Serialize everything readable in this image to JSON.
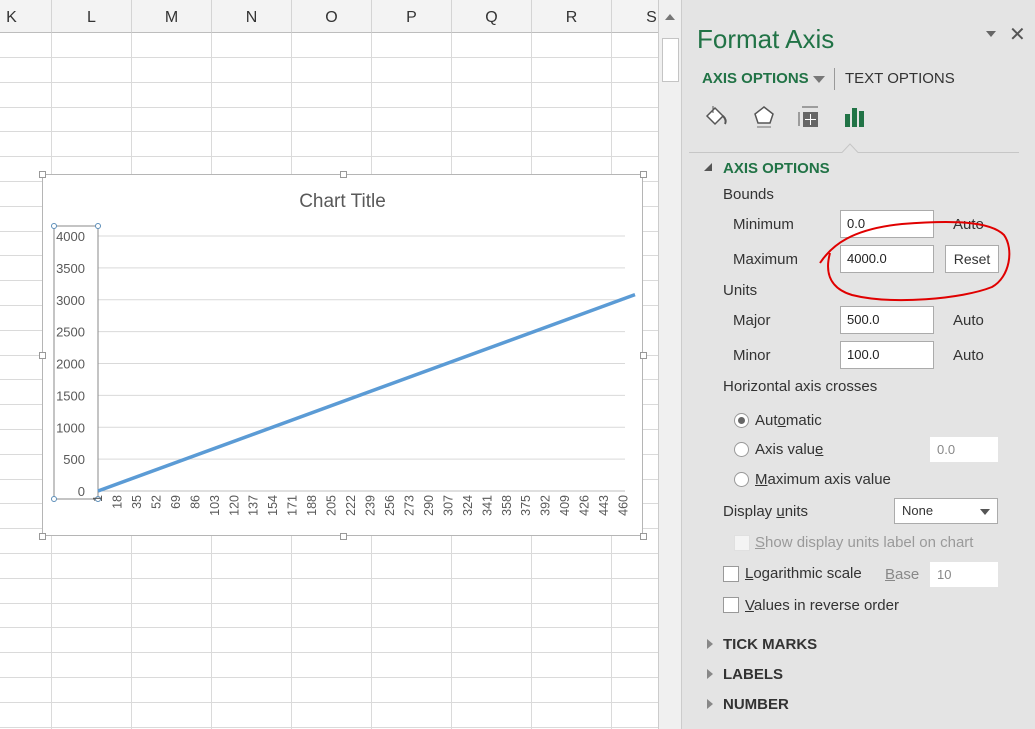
{
  "spreadsheet": {
    "columns": [
      "K",
      "L",
      "M",
      "N",
      "O",
      "P",
      "Q",
      "R",
      "S"
    ]
  },
  "chart": {
    "title": "Chart Title"
  },
  "chart_data": {
    "type": "line",
    "title": "Chart Title",
    "xlabel": "",
    "ylabel": "",
    "ylim": [
      0,
      4000
    ],
    "y_ticks": [
      "0",
      "500",
      "1000",
      "1500",
      "2000",
      "2500",
      "3000",
      "3500",
      "4000"
    ],
    "x_tick_labels": [
      "1",
      "18",
      "35",
      "52",
      "69",
      "86",
      "103",
      "120",
      "137",
      "154",
      "171",
      "188",
      "205",
      "222",
      "239",
      "256",
      "273",
      "290",
      "307",
      "324",
      "341",
      "358",
      "375",
      "392",
      "409",
      "426",
      "443",
      "460"
    ],
    "x_range": [
      1,
      470
    ],
    "series": [
      {
        "x": [
          1,
          470
        ],
        "y": [
          0,
          3080
        ],
        "color": "#5b9bd5"
      }
    ],
    "grid": "horizontal",
    "legend": "none"
  },
  "panel": {
    "title": "Format Axis",
    "tab_axis_options": "AXIS OPTIONS",
    "tab_text_options": "TEXT OPTIONS",
    "icons": [
      "fill-line-icon",
      "effects-icon",
      "size-properties-icon",
      "axis-options-icon"
    ],
    "section_axis_options": "AXIS OPTIONS",
    "bounds_label": "Bounds",
    "minimum_label": "Minimum",
    "minimum_value": "0.0",
    "minimum_auto": "Auto",
    "maximum_label": "Maximum",
    "maximum_value": "4000.0",
    "reset_label": "Reset",
    "units_label": "Units",
    "major_label": "Major",
    "major_value": "500.0",
    "major_auto": "Auto",
    "minor_label": "Minor",
    "minor_value": "100.0",
    "minor_auto": "Auto",
    "crosses_label": "Horizontal axis crosses",
    "radio_automatic_pre": "Aut",
    "radio_automatic_u": "o",
    "radio_automatic_post": "matic",
    "radio_axis_value_pre": "Axis valu",
    "radio_axis_value_u": "e",
    "axis_value": "0.0",
    "radio_max_u": "M",
    "radio_max_post": "aximum axis value",
    "display_units_pre": "Display ",
    "display_units_u": "u",
    "display_units_post": "nits",
    "display_units_value": "None",
    "show_units_u": "S",
    "show_units_post": "how display units label on chart",
    "log_u": "L",
    "log_post": "ogarithmic scale",
    "base_u": "B",
    "base_post": "ase",
    "base_value": "10",
    "reverse_u": "V",
    "reverse_post": "alues in reverse order",
    "tick_marks": "TICK MARKS",
    "labels": "LABELS",
    "number": "NUMBER",
    "annotation_color": "#e00000",
    "accent_color": "#217346"
  }
}
